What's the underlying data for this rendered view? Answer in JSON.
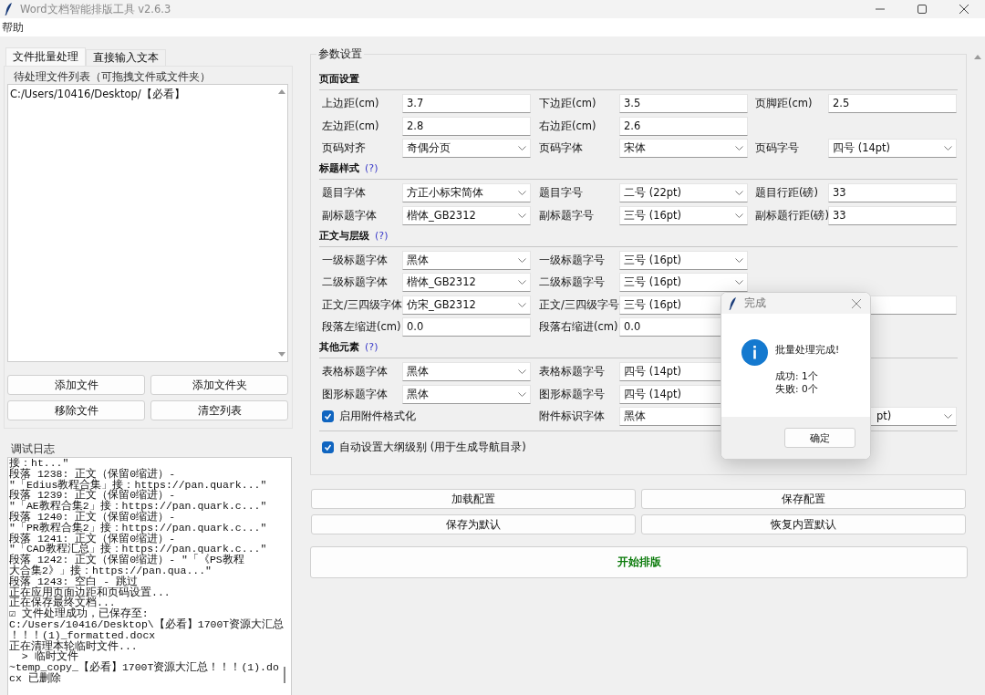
{
  "window": {
    "title": "Word文档智能排版工具 v2.6.3"
  },
  "menu": [
    "帮助"
  ],
  "tabs": [
    {
      "label": "文件批量处理",
      "selected": true
    },
    {
      "label": "直接输入文本",
      "selected": false
    }
  ],
  "file_list": {
    "title": "待处理文件列表（可拖拽文件或文件夹）",
    "items": [
      "C:/Users/10416/Desktop/【必看】"
    ]
  },
  "file_buttons": [
    "添加文件",
    "添加文件夹",
    "移除文件",
    "清空列表"
  ],
  "log": {
    "title": "调试日志",
    "lines": [
      "接：ht...\"",
      "段落 1238: 正文（保留0缩进）-",
      "\"「Edius教程合集」接：https://pan.quark...\"",
      "段落 1239: 正文（保留0缩进）-",
      "\"「AE教程合集2」接：https://pan.quark.c...\"",
      "段落 1240: 正文（保留0缩进）-",
      "\"「PR教程合集2」接：https://pan.quark.c...\"",
      "段落 1241: 正文（保留0缩进）-",
      "\"「CAD教程汇总」接：https://pan.quark.c...\"",
      "段落 1242: 正文（保留0缩进）- \"「《PS教程",
      "大合集2》」接：https://pan.qua...\"",
      "段落 1243: 空白 - 跳过",
      "正在应用页面边距和页码设置...",
      "正在保存最终文档...",
      "☑ 文件处理成功，已保存至:",
      "C:/Users/10416/Desktop\\【必看】1700T资源大汇总",
      "！！！(1)_formatted.docx",
      "正在清理本轮临时文件...",
      "  > 临时文件",
      "~temp_copy_【必看】1700T资源大汇总！！！(1).do",
      "cx 已删除"
    ]
  },
  "params": {
    "title": "参数设置",
    "sections": [
      {
        "title": "页面设置",
        "rows": [
          [
            {
              "label": "上边距(cm)",
              "kind": "entry",
              "value": "3.7"
            },
            {
              "label": "下边距(cm)",
              "kind": "entry",
              "value": "3.5"
            },
            {
              "label": "页脚距(cm)",
              "kind": "entry",
              "value": "2.5"
            }
          ],
          [
            {
              "label": "左边距(cm)",
              "kind": "entry",
              "value": "2.8"
            },
            {
              "label": "右边距(cm)",
              "kind": "entry",
              "value": "2.6"
            },
            null
          ],
          [
            {
              "label": "页码对齐",
              "kind": "combo",
              "value": "奇偶分页"
            },
            {
              "label": "页码字体",
              "kind": "combo",
              "value": "宋体"
            },
            {
              "label": "页码字号",
              "kind": "combo",
              "value": "四号 (14pt)"
            }
          ]
        ]
      },
      {
        "title": "标题样式",
        "help": "(?)",
        "rows": [
          [
            {
              "label": "题目字体",
              "kind": "combo",
              "value": "方正小标宋简体"
            },
            {
              "label": "题目字号",
              "kind": "combo",
              "value": "二号 (22pt)"
            },
            {
              "label": "题目行距(磅)",
              "kind": "entry",
              "value": "33"
            }
          ],
          [
            {
              "label": "副标题字体",
              "kind": "combo",
              "value": "楷体_GB2312"
            },
            {
              "label": "副标题字号",
              "kind": "combo",
              "value": "三号 (16pt)"
            },
            {
              "label": "副标题行距(磅)",
              "kind": "entry",
              "value": "33"
            }
          ]
        ]
      },
      {
        "title": "正文与层级",
        "help": "(?)",
        "rows": [
          [
            {
              "label": "一级标题字体",
              "kind": "combo",
              "value": "黑体"
            },
            {
              "label": "一级标题字号",
              "kind": "combo",
              "value": "三号 (16pt)"
            },
            null
          ],
          [
            {
              "label": "二级标题字体",
              "kind": "combo",
              "value": "楷体_GB2312"
            },
            {
              "label": "二级标题字号",
              "kind": "combo",
              "value": "三号 (16pt)"
            },
            null
          ],
          [
            {
              "label": "正文/三四级字体",
              "kind": "combo",
              "value": "仿宋_GB2312"
            },
            {
              "label": "正文/三四级字号",
              "kind": "combo",
              "value": "三号 (16pt)"
            },
            {
              "kind": "entry"
            }
          ],
          [
            {
              "label": "段落左缩进(cm)",
              "kind": "entry",
              "value": "0.0"
            },
            {
              "label": "段落右缩进(cm)",
              "kind": "entry",
              "value": "0.0"
            },
            null
          ]
        ]
      },
      {
        "title": "其他元素",
        "help": "(?)",
        "rows": [
          [
            {
              "label": "表格标题字体",
              "kind": "combo",
              "value": "黑体"
            },
            {
              "label": "表格标题字号",
              "kind": "combo",
              "value": "四号 (14pt)"
            },
            null
          ],
          [
            {
              "label": "图形标题字体",
              "kind": "combo",
              "value": "黑体"
            },
            {
              "label": "图形标题字号",
              "kind": "combo",
              "value": "四号 (14pt)"
            },
            null
          ],
          [
            {
              "label": "启用附件格式化",
              "kind": "checkbox",
              "checked": true
            },
            {
              "label": "附件标识字体",
              "kind": "combo",
              "value": "黑体"
            },
            {
              "kind": "combo",
              "value": "pt)"
            }
          ]
        ]
      }
    ],
    "outline_option": {
      "label": "自动设置大纲级别 (用于生成导航目录)",
      "checked": true
    }
  },
  "config_buttons": [
    "加载配置",
    "保存配置",
    "保存为默认",
    "恢复内置默认"
  ],
  "start_button": "开始排版",
  "dialog": {
    "title": "完成",
    "heading": "批量处理完成!",
    "lines": [
      "成功: 1个",
      "失败: 0个"
    ],
    "button": "确定"
  }
}
